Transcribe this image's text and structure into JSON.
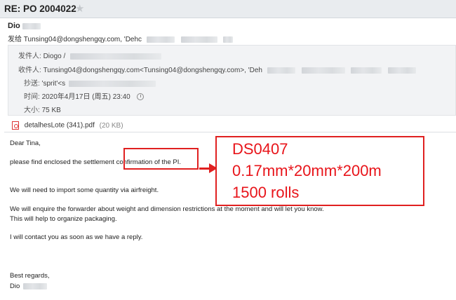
{
  "email": {
    "subject": "RE: PO 2004022",
    "sender_name": "Dio",
    "sendto_prefix": "发给",
    "sendto_text": "Tunsing04@dongshengqy.com, 'Dehc"
  },
  "meta": {
    "from_label": "发件人:",
    "from_value": "Diogo /",
    "to_label": "收件人:",
    "to_value": "Tunsing04@dongshengqy.com<Tunsing04@dongshengqy.com>,  'Deh",
    "cc_label": "抄送:",
    "cc_value": "'sprit'<s",
    "time_label": "时间:",
    "time_value": "2020年4月17日 (周五) 23:40",
    "size_label": "大小:",
    "size_value": "75 KB"
  },
  "attachment": {
    "name": "detalhesLote (341).pdf",
    "size": "(20 KB)"
  },
  "body": {
    "greeting": "Dear Tina,",
    "line1": "please find enclosed the settlement confirmation of the PI.",
    "line2": "We will need to import some quantity via airfreight.",
    "line3": "We will enquire the forwarder about weight and dimension restrictions at the moment and will let you know.",
    "line4": "This will help to organize packaging.",
    "line5": "I will contact you as soon as we have a reply.",
    "closing": "Best regards,",
    "signature": "Dio"
  },
  "annotation": {
    "line1": "DS0407",
    "line2": "0.17mm*20mm*200m",
    "line3": "1500 rolls",
    "color": "#e8141a"
  }
}
